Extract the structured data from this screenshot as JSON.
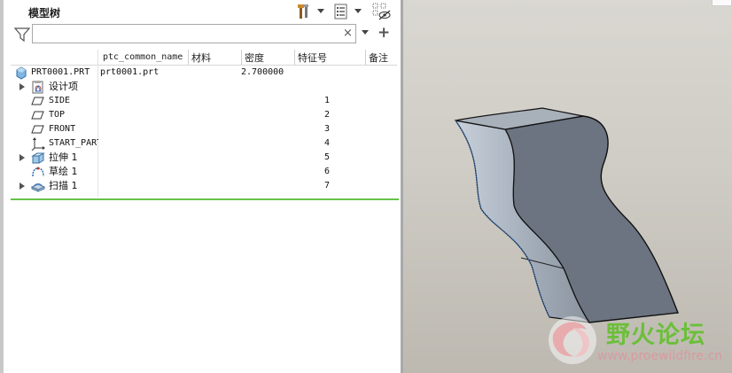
{
  "panel": {
    "title": "模型树",
    "search": {
      "value": "",
      "placeholder": ""
    },
    "clear_label": "×"
  },
  "columns": [
    {
      "label": "ptc_common_name"
    },
    {
      "label": "材料"
    },
    {
      "label": "密度"
    },
    {
      "label": "特征号"
    },
    {
      "label": "备注"
    }
  ],
  "tree": [
    {
      "name": "PRT0001.PRT",
      "icon": "part-icon",
      "expandable": false,
      "common_name": "prt0001.prt",
      "density": "2.700000",
      "feature_no": ""
    },
    {
      "name": "设计项",
      "icon": "design-items-icon",
      "expandable": true,
      "common_name": "",
      "density": "",
      "feature_no": ""
    },
    {
      "name": "SIDE",
      "icon": "datum-plane-icon",
      "expandable": false,
      "common_name": "",
      "density": "",
      "feature_no": "1"
    },
    {
      "name": "TOP",
      "icon": "datum-plane-icon",
      "expandable": false,
      "common_name": "",
      "density": "",
      "feature_no": "2"
    },
    {
      "name": "FRONT",
      "icon": "datum-plane-icon",
      "expandable": false,
      "common_name": "",
      "density": "",
      "feature_no": "3"
    },
    {
      "name": "START_PART",
      "icon": "coordinate-system-icon",
      "expandable": false,
      "common_name": "",
      "density": "",
      "feature_no": "4"
    },
    {
      "name": "拉伸 1",
      "icon": "extrude-icon",
      "expandable": true,
      "common_name": "",
      "density": "",
      "feature_no": "5"
    },
    {
      "name": "草绘 1",
      "icon": "sketch-icon",
      "expandable": false,
      "common_name": "",
      "density": "",
      "feature_no": "6"
    },
    {
      "name": "扫描 1",
      "icon": "sweep-icon",
      "expandable": true,
      "common_name": "",
      "density": "",
      "feature_no": "7"
    }
  ],
  "watermark": {
    "title": "野火论坛",
    "url": "www.proewildfire.cn"
  },
  "colors": {
    "accent_line": "#67c24a",
    "part_body": "#6b7480",
    "part_edge": "#111111"
  }
}
